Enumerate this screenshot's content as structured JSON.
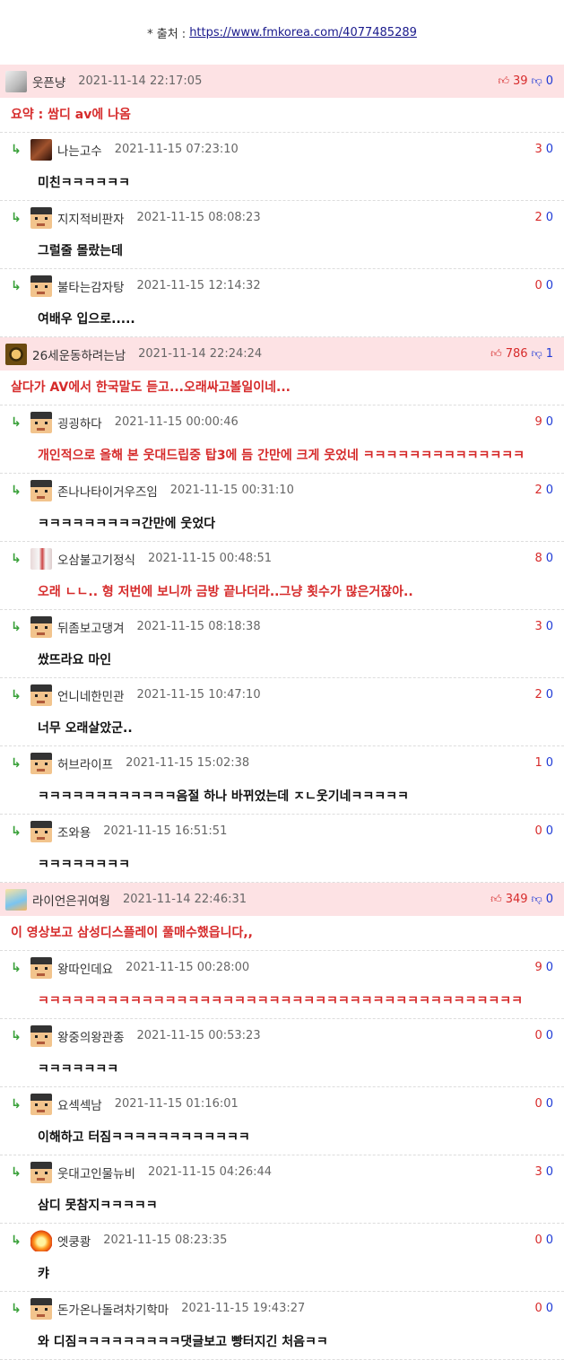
{
  "source": {
    "label": "* 출처 :",
    "url": "https://www.fmkorea.com/4077485289"
  },
  "threads": [
    {
      "nick": "웃픈냥",
      "date": "2021-11-14 22:17:05",
      "up": "39",
      "down": "0",
      "avatar": "cat",
      "text": "요약 : 쌈디 av에 나옴",
      "replies": [
        {
          "nick": "나는고수",
          "date": "2021-11-15 07:23:10",
          "up": "3",
          "down": "0",
          "avatar": "brown",
          "text": "미친ㅋㅋㅋㅋㅋㅋ",
          "style": "normal"
        },
        {
          "nick": "지지적비판자",
          "date": "2021-11-15 08:08:23",
          "up": "2",
          "down": "0",
          "avatar": "pixel",
          "text": "그럴줄 몰랐는데",
          "style": "normal"
        },
        {
          "nick": "불타는감자탕",
          "date": "2021-11-15 12:14:32",
          "up": "0",
          "down": "0",
          "avatar": "pixel",
          "text": "여배우 입으로.....",
          "style": "normal"
        }
      ]
    },
    {
      "nick": "26세운동하려는남",
      "date": "2021-11-14 22:24:24",
      "up": "786",
      "down": "1",
      "avatar": "frog",
      "text": "살다가 AV에서 한국말도 듣고...오래싸고볼일이네...",
      "replies": [
        {
          "nick": "굉굉하다",
          "date": "2021-11-15 00:00:46",
          "up": "9",
          "down": "0",
          "avatar": "pixel",
          "text": "개인적으로 올해 본 웃대드립중 탑3에 듬 간만에 크게 웃었네 ㅋㅋㅋㅋㅋㅋㅋㅋㅋㅋㅋㅋㅋㅋ",
          "style": "best"
        },
        {
          "nick": "존나나타이거우즈임",
          "date": "2021-11-15 00:31:10",
          "up": "2",
          "down": "0",
          "avatar": "pixel",
          "text": "ㅋㅋㅋㅋㅋㅋㅋㅋㅋ간만에 웃었다",
          "style": "normal"
        },
        {
          "nick": "오삼불고기정식",
          "date": "2021-11-15 00:48:51",
          "up": "8",
          "down": "0",
          "avatar": "girl",
          "text": "오래 ㄴㄴ.. 형 저번에 보니까 금방 끝나더라..그냥 횟수가 많은거잖아..",
          "style": "best"
        },
        {
          "nick": "뒤좀보고댕겨",
          "date": "2021-11-15 08:18:38",
          "up": "3",
          "down": "0",
          "avatar": "pixel",
          "text": "쌌뜨라요 마인",
          "style": "normal"
        },
        {
          "nick": "언니네한민관",
          "date": "2021-11-15 10:47:10",
          "up": "2",
          "down": "0",
          "avatar": "pixel",
          "text": "너무 오래살았군..",
          "style": "normal"
        },
        {
          "nick": "허브라이프",
          "date": "2021-11-15 15:02:38",
          "up": "1",
          "down": "0",
          "avatar": "pixel",
          "text": "ㅋㅋㅋㅋㅋㅋㅋㅋㅋㅋㅋㅋ음절 하나 바뀌었는데 ㅈㄴ웃기네ㅋㅋㅋㅋㅋ",
          "style": "normal"
        },
        {
          "nick": "조와용",
          "date": "2021-11-15 16:51:51",
          "up": "0",
          "down": "0",
          "avatar": "pixel",
          "text": "ㅋㅋㅋㅋㅋㅋㅋㅋ",
          "style": "normal"
        }
      ]
    },
    {
      "nick": "라이언은귀여웡",
      "date": "2021-11-14 22:46:31",
      "up": "349",
      "down": "0",
      "avatar": "rayman",
      "text": "이 영상보고 삼성디스플레이 풀매수했읍니다,,",
      "replies": [
        {
          "nick": "왕따인데요",
          "date": "2021-11-15 00:28:00",
          "up": "9",
          "down": "0",
          "avatar": "pixel",
          "text": "ㅋㅋㅋㅋㅋㅋㅋㅋㅋㅋㅋㅋㅋㅋㅋㅋㅋㅋㅋㅋㅋㅋㅋㅋㅋㅋㅋㅋㅋㅋㅋㅋㅋㅋㅋㅋㅋㅋㅋㅋㅋㅋ",
          "style": "best"
        },
        {
          "nick": "왕중의왕관종",
          "date": "2021-11-15 00:53:23",
          "up": "0",
          "down": "0",
          "avatar": "pixel",
          "text": "ㅋㅋㅋㅋㅋㅋㅋ",
          "style": "normal"
        },
        {
          "nick": "요섹섹남",
          "date": "2021-11-15 01:16:01",
          "up": "0",
          "down": "0",
          "avatar": "pixel",
          "text": "이해하고 터짐ㅋㅋㅋㅋㅋㅋㅋㅋㅋㅋㅋㅋ",
          "style": "normal"
        },
        {
          "nick": "웃대고인물뉴비",
          "date": "2021-11-15 04:26:44",
          "up": "3",
          "down": "0",
          "avatar": "pixel",
          "text": "삼디 못참지ㅋㅋㅋㅋㅋ",
          "style": "normal"
        },
        {
          "nick": "엣쿵쾅",
          "date": "2021-11-15 08:23:35",
          "up": "0",
          "down": "0",
          "avatar": "fire",
          "text": "캬",
          "style": "normal"
        },
        {
          "nick": "돈가온나돌려차기학마",
          "date": "2021-11-15 19:43:27",
          "up": "0",
          "down": "0",
          "avatar": "pixel",
          "text": "와 디짐ㅋㅋㅋㅋㅋㅋㅋㅋㅋ댓글보고 빵터지긴 처음ㅋㅋ",
          "style": "normal"
        }
      ]
    }
  ],
  "icons": {
    "reply_arrow": "reply-arrow-icon",
    "thumb_up": "thumb-up-icon",
    "thumb_down": "thumb-down-icon"
  },
  "colors": {
    "top_bg": "#fde2e4",
    "best_text": "#d62b2b",
    "up": "#d72b2b",
    "down": "#1f3ad6",
    "reply_arrow": "#3aa13a"
  }
}
